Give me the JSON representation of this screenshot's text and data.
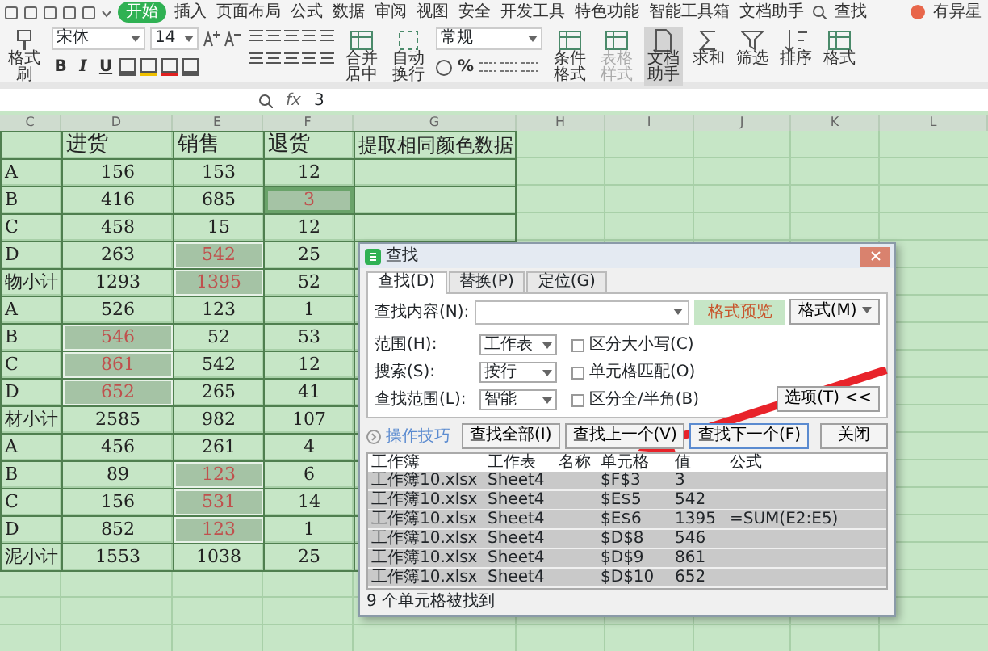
{
  "menu_tabs": [
    {
      "label": "开始",
      "selected": true
    },
    {
      "label": "插入",
      "selected": false
    },
    {
      "label": "页面布局",
      "selected": false
    },
    {
      "label": "公式",
      "selected": false
    },
    {
      "label": "数据",
      "selected": false
    },
    {
      "label": "审阅",
      "selected": false
    },
    {
      "label": "视图",
      "selected": false
    },
    {
      "label": "安全",
      "selected": false
    },
    {
      "label": "开发工具",
      "selected": false
    },
    {
      "label": "特色功能",
      "selected": false
    },
    {
      "label": "智能工具箱",
      "selected": false
    },
    {
      "label": "文档助手",
      "selected": false
    }
  ],
  "search_label": "查找",
  "user_name": "有异星",
  "ribbon": {
    "format_painter": "格式刷",
    "font": "宋体",
    "font_size": "14",
    "style_buttons": [
      "B",
      "I",
      "U"
    ],
    "number_format": "常规",
    "percent": "%",
    "buttons": [
      {
        "label": "合并居中",
        "disabled": false,
        "selected": false
      },
      {
        "label": "自动换行",
        "disabled": false,
        "selected": false
      },
      {
        "label": "条件格式",
        "disabled": false,
        "selected": false
      },
      {
        "label": "表格样式",
        "disabled": true,
        "selected": false
      },
      {
        "label": "文档助手",
        "disabled": false,
        "selected": true
      },
      {
        "label": "求和",
        "disabled": false,
        "selected": false
      },
      {
        "label": "筛选",
        "disabled": false,
        "selected": false
      },
      {
        "label": "排序",
        "disabled": false,
        "selected": false
      },
      {
        "label": "格式",
        "disabled": false,
        "selected": false
      }
    ]
  },
  "formula_bar": {
    "fx": "fx",
    "value": "3"
  },
  "sheet": {
    "columns": [
      "C",
      "D",
      "E",
      "F",
      "G",
      "H",
      "I",
      "J",
      "K",
      "L"
    ],
    "rows": [
      [
        {
          "text": ""
        },
        {
          "text": "进货"
        },
        {
          "text": "销售"
        },
        {
          "text": "退货"
        },
        {
          "text": "提取相同颜色数据"
        }
      ],
      [
        {
          "text": "A"
        },
        {
          "text": "156"
        },
        {
          "text": "153"
        },
        {
          "text": "12"
        }
      ],
      [
        {
          "text": "B"
        },
        {
          "text": "416"
        },
        {
          "text": "685"
        },
        {
          "text": "3",
          "highlighted": true,
          "active": true
        }
      ],
      [
        {
          "text": "C"
        },
        {
          "text": "458"
        },
        {
          "text": "15"
        },
        {
          "text": "12"
        }
      ],
      [
        {
          "text": "D"
        },
        {
          "text": "263"
        },
        {
          "text": "542",
          "highlighted": true
        },
        {
          "text": "25"
        }
      ],
      [
        {
          "text": "物小计"
        },
        {
          "text": "1293"
        },
        {
          "text": "1395",
          "highlighted": true
        },
        {
          "text": "52"
        }
      ],
      [
        {
          "text": "A"
        },
        {
          "text": "526"
        },
        {
          "text": "123"
        },
        {
          "text": "1"
        }
      ],
      [
        {
          "text": "B"
        },
        {
          "text": "546",
          "highlighted": true
        },
        {
          "text": "52"
        },
        {
          "text": "53"
        }
      ],
      [
        {
          "text": "C"
        },
        {
          "text": "861",
          "highlighted": true
        },
        {
          "text": "542"
        },
        {
          "text": "12"
        }
      ],
      [
        {
          "text": "D"
        },
        {
          "text": "652",
          "highlighted": true
        },
        {
          "text": "265"
        },
        {
          "text": "41"
        }
      ],
      [
        {
          "text": "材小计"
        },
        {
          "text": "2585"
        },
        {
          "text": "982"
        },
        {
          "text": "107"
        }
      ],
      [
        {
          "text": "A"
        },
        {
          "text": "456"
        },
        {
          "text": "261"
        },
        {
          "text": "4"
        }
      ],
      [
        {
          "text": "B"
        },
        {
          "text": "89"
        },
        {
          "text": "123",
          "highlighted": true
        },
        {
          "text": "6"
        }
      ],
      [
        {
          "text": "C"
        },
        {
          "text": "156"
        },
        {
          "text": "531",
          "highlighted": true
        },
        {
          "text": "14"
        }
      ],
      [
        {
          "text": "D"
        },
        {
          "text": "852"
        },
        {
          "text": "123",
          "highlighted": true
        },
        {
          "text": "1"
        }
      ],
      [
        {
          "text": "泥小计"
        },
        {
          "text": "1553"
        },
        {
          "text": "1038"
        },
        {
          "text": "25"
        }
      ]
    ]
  },
  "dialog": {
    "title": "查找",
    "tabs": [
      {
        "label": "查找(D)",
        "selected": true
      },
      {
        "label": "替换(P)",
        "selected": false
      },
      {
        "label": "定位(G)",
        "selected": false
      }
    ],
    "find_label": "查找内容(N):",
    "format_preview": "格式预览",
    "format_button": "格式(M)",
    "options": [
      {
        "label": "范围(H):",
        "value": "工作表",
        "check": "区分大小写(C)",
        "checked": false
      },
      {
        "label": "搜索(S):",
        "value": "按行",
        "check": "单元格匹配(O)",
        "checked": false
      },
      {
        "label": "查找范围(L):",
        "value": "智能",
        "check": "区分全/半角(B)",
        "checked": false
      }
    ],
    "options_button": "选项(T) <<",
    "tips_link": "操作技巧",
    "buttons": [
      "查找全部(I)",
      "查找上一个(V)",
      "查找下一个(F)",
      "关闭"
    ],
    "results": {
      "columns": [
        "工作簿",
        "工作表",
        "名称",
        "单元格",
        "值",
        "公式"
      ],
      "rows": [
        [
          "工作簿10.xlsx",
          "Sheet4",
          "",
          "$F$3",
          "3",
          ""
        ],
        [
          "工作簿10.xlsx",
          "Sheet4",
          "",
          "$E$5",
          "542",
          ""
        ],
        [
          "工作簿10.xlsx",
          "Sheet4",
          "",
          "$E$6",
          "1395",
          "=SUM(E2:E5)"
        ],
        [
          "工作簿10.xlsx",
          "Sheet4",
          "",
          "$D$8",
          "546",
          ""
        ],
        [
          "工作簿10.xlsx",
          "Sheet4",
          "",
          "$D$9",
          "861",
          ""
        ],
        [
          "工作簿10.xlsx",
          "Sheet4",
          "",
          "$D$10",
          "652",
          ""
        ]
      ]
    },
    "status": "9 个单元格被找到"
  }
}
